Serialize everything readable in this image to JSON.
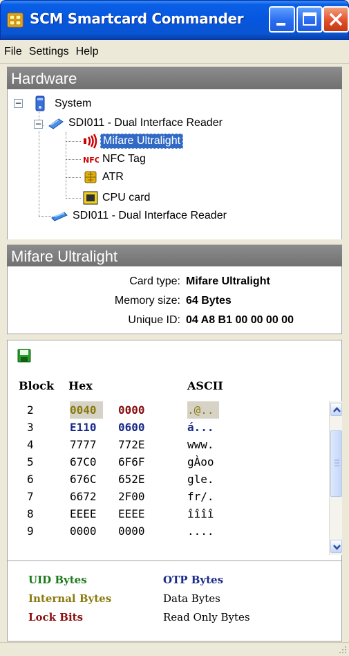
{
  "window": {
    "title": "SCM Smartcard Commander",
    "app_icon": "scm-logo-icon"
  },
  "menu": [
    "File",
    "Settings",
    "Help"
  ],
  "hardware": {
    "header": "Hardware",
    "tree": {
      "root": "System",
      "reader1": "SDI011 - Dual Interface Reader",
      "children": [
        "Mifare Ultralight",
        "NFC Tag",
        "ATR",
        "CPU card"
      ],
      "reader2": "SDI011 - Dual Interface Reader",
      "selected": "Mifare Ultralight"
    }
  },
  "details": {
    "header": "Mifare Ultralight",
    "card_type_label": "Card type:",
    "card_type": "Mifare Ultralight",
    "memory_size_label": "Memory size:",
    "memory_size": "64 Bytes",
    "uid_label": "Unique ID:",
    "uid": "04 A8 B1 00 00 00 00"
  },
  "memory": {
    "columns": [
      "Block",
      "Hex",
      "ASCII"
    ],
    "rows": [
      {
        "block": "2",
        "hex1": "0040",
        "hex2": "0000",
        "ascii": ".@.."
      },
      {
        "block": "3",
        "hex1": "E110",
        "hex2": "0600",
        "ascii": "á..."
      },
      {
        "block": "4",
        "hex1": "7777",
        "hex2": "772E",
        "ascii": "www."
      },
      {
        "block": "5",
        "hex1": "67C0",
        "hex2": "6F6F",
        "ascii": "gÀoo"
      },
      {
        "block": "6",
        "hex1": "676C",
        "hex2": "652E",
        "ascii": "gle."
      },
      {
        "block": "7",
        "hex1": "6672",
        "hex2": "2F00",
        "ascii": "fr/."
      },
      {
        "block": "8",
        "hex1": "EEEE",
        "hex2": "EEEE",
        "ascii": "îîîî"
      },
      {
        "block": "9",
        "hex1": "0000",
        "hex2": "0000",
        "ascii": "...."
      }
    ],
    "legend": {
      "uid": "UID Bytes",
      "otp": "OTP Bytes",
      "internal": "Internal Bytes",
      "data": "Data Bytes",
      "lock": "Lock Bits",
      "readonly": "Read Only Bytes"
    },
    "colors": {
      "uid": "#1a7a1a",
      "otp": "#1a2a8a",
      "internal": "#8a7a10",
      "lock": "#8a1010",
      "internal_bg": "#d6d3c6",
      "lock_bg": "#ffffff"
    }
  }
}
